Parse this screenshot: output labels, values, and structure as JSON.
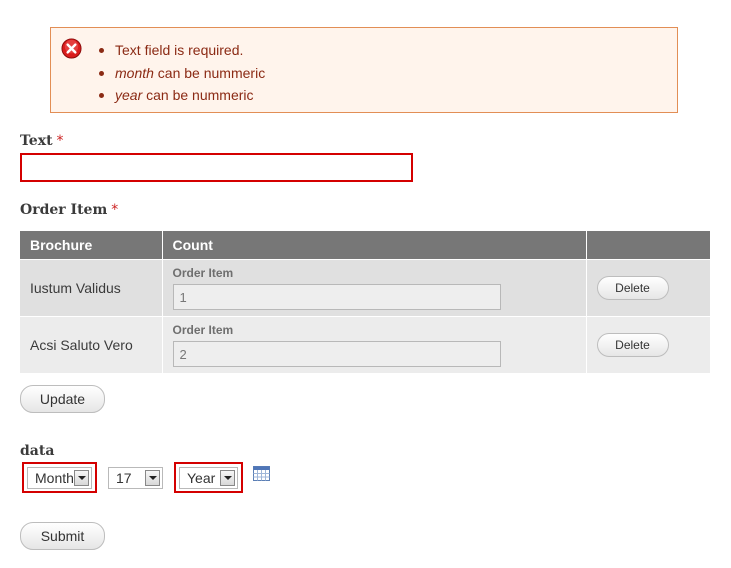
{
  "errors": {
    "line1": "Text field is required.",
    "line2_field": "month",
    "line2_rest": " can be nummeric",
    "line3_field": "year",
    "line3_rest": " can be nummeric"
  },
  "text_field": {
    "label": "Text",
    "required_mark": "*",
    "value": ""
  },
  "order_item": {
    "label": "Order Item",
    "required_mark": "*",
    "columns": [
      "Brochure",
      "Count",
      ""
    ],
    "rows": [
      {
        "brochure": "Iustum Validus",
        "count_label": "Order Item",
        "count_value": "1",
        "delete_label": "Delete"
      },
      {
        "brochure": "Acsi Saluto Vero",
        "count_label": "Order Item",
        "count_value": "2",
        "delete_label": "Delete"
      }
    ],
    "update_label": "Update"
  },
  "data_field": {
    "label": "data",
    "month": "Month",
    "day": "17",
    "year": "Year",
    "calendar_icon": "calendar-icon"
  },
  "submit_label": "Submit",
  "colors": {
    "error_border": "#e28e55",
    "error_bg": "#fff4ec",
    "error_text": "#8b2a14",
    "invalid_border": "#d40000",
    "table_header": "#777777"
  }
}
